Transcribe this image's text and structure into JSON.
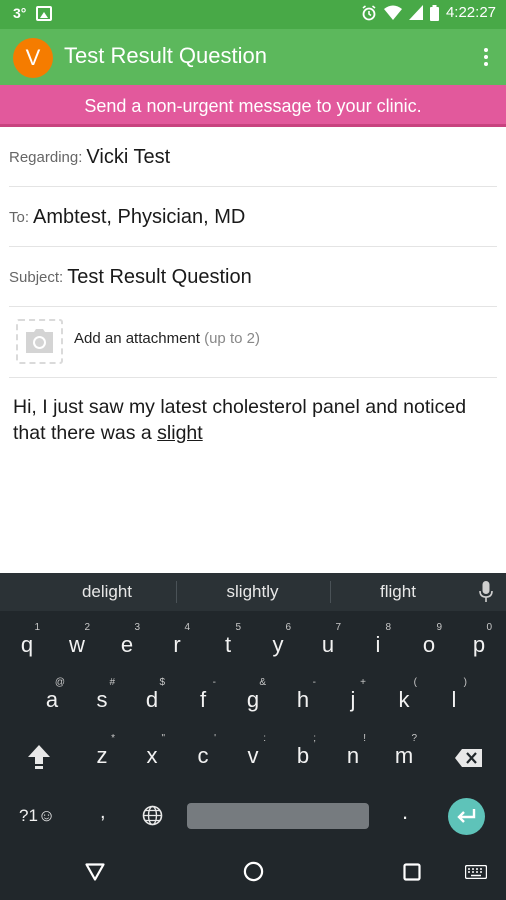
{
  "status_bar": {
    "left_text": "3°",
    "icons_left": [
      "image-icon"
    ],
    "icons_right": [
      "alarm-icon",
      "wifi-icon",
      "signal-icon",
      "battery-icon"
    ],
    "time": "4:22:27"
  },
  "app_bar": {
    "avatar_letter": "V",
    "title": "Test Result Question",
    "menu_icon": "overflow-menu-icon",
    "color": "#5cb85c"
  },
  "banner": {
    "text": "Send a non-urgent message to your clinic.",
    "color": "#e2599c"
  },
  "form": {
    "regarding": {
      "label": "Regarding:",
      "value": "Vicki Test"
    },
    "to": {
      "label": "To:",
      "value": "Ambtest, Physician, MD"
    },
    "subject": {
      "label": "Subject:",
      "value": "Test Result Question"
    },
    "attachment": {
      "label": "Add an attachment",
      "hint": "(up to 2)",
      "icon": "camera-icon"
    }
  },
  "message": {
    "text_before": "Hi, I just saw my latest cholesterol panel and noticed that there was a ",
    "composing_word": "slight"
  },
  "keyboard": {
    "suggestions": [
      "delight",
      "slightly",
      "flight"
    ],
    "row1": [
      {
        "key": "q",
        "hint": "1"
      },
      {
        "key": "w",
        "hint": "2"
      },
      {
        "key": "e",
        "hint": "3"
      },
      {
        "key": "r",
        "hint": "4"
      },
      {
        "key": "t",
        "hint": "5"
      },
      {
        "key": "y",
        "hint": "6"
      },
      {
        "key": "u",
        "hint": "7"
      },
      {
        "key": "i",
        "hint": "8"
      },
      {
        "key": "o",
        "hint": "9"
      },
      {
        "key": "p",
        "hint": "0"
      }
    ],
    "row2": [
      {
        "key": "a",
        "hint": "@"
      },
      {
        "key": "s",
        "hint": "#"
      },
      {
        "key": "d",
        "hint": "$"
      },
      {
        "key": "f",
        "hint": "-"
      },
      {
        "key": "g",
        "hint": "&"
      },
      {
        "key": "h",
        "hint": "-"
      },
      {
        "key": "j",
        "hint": "+"
      },
      {
        "key": "k",
        "hint": "("
      },
      {
        "key": "l",
        "hint": ")"
      }
    ],
    "row3": [
      {
        "key": "z",
        "hint": "*"
      },
      {
        "key": "x",
        "hint": "\""
      },
      {
        "key": "c",
        "hint": "'"
      },
      {
        "key": "v",
        "hint": ":"
      },
      {
        "key": "b",
        "hint": ";"
      },
      {
        "key": "n",
        "hint": "!"
      },
      {
        "key": "m",
        "hint": "?"
      }
    ],
    "symbols_label": "?1☺",
    "comma": ",",
    "period": ".",
    "accent_color": "#5ec3b9"
  },
  "nav_bar": {
    "icons": [
      "back-icon",
      "home-icon",
      "recents-icon",
      "keyboard-switch-icon"
    ]
  }
}
